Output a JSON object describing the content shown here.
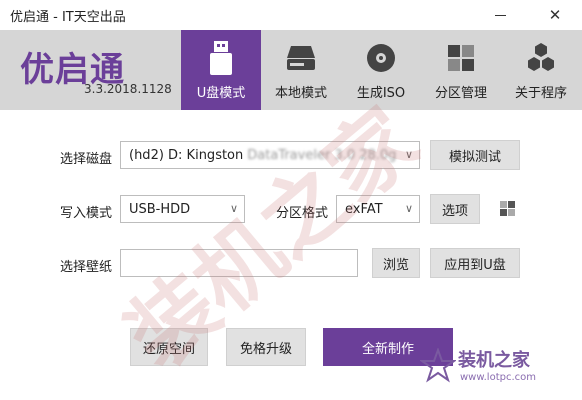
{
  "window": {
    "title": "优启通 - IT天空出品",
    "minimize": "—",
    "close": "✕"
  },
  "brand": {
    "logo": "优启通",
    "version": "3.3.2018.1128",
    "accent": "#6b3f99"
  },
  "tabs": [
    {
      "label": "U盘模式",
      "icon": "usb-drive-icon",
      "active": true
    },
    {
      "label": "本地模式",
      "icon": "hard-drive-icon",
      "active": false
    },
    {
      "label": "生成ISO",
      "icon": "disc-icon",
      "active": false
    },
    {
      "label": "分区管理",
      "icon": "partition-grid-icon",
      "active": false
    },
    {
      "label": "关于程序",
      "icon": "hexagon-cluster-icon",
      "active": false
    }
  ],
  "form": {
    "disk_label": "选择磁盘",
    "disk_value": "(hd2) D: Kingston",
    "disk_value_blurred": "DataTraveler 3.0 28.0g",
    "simulate_button": "模拟测试",
    "write_mode_label": "写入模式",
    "write_mode_value": "USB-HDD",
    "partition_format_label": "分区格式",
    "partition_format_value": "exFAT",
    "options_button": "选项",
    "wallpaper_label": "选择壁纸",
    "wallpaper_value": "",
    "browse_button": "浏览",
    "apply_button": "应用到U盘"
  },
  "actions": {
    "restore_button": "还原空间",
    "upgrade_button": "免格升级",
    "create_button": "全新制作"
  },
  "watermark": {
    "text": "装机之家",
    "site_name": "装机之家",
    "site_url": "www.lotpc.com"
  }
}
